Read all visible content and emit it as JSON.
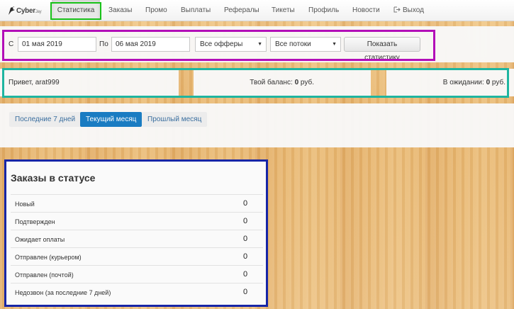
{
  "navbar": {
    "logo_text": "Cyber",
    "logo_small": "Jay",
    "items": [
      {
        "label": "Статистика"
      },
      {
        "label": "Заказы"
      },
      {
        "label": "Промо"
      },
      {
        "label": "Выплаты"
      },
      {
        "label": "Рефералы"
      },
      {
        "label": "Тикеты"
      },
      {
        "label": "Профиль"
      },
      {
        "label": "Новости"
      },
      {
        "label": "Выход"
      }
    ],
    "active_index": 0
  },
  "filters": {
    "from_label": "С",
    "from_value": "01 мая 2019",
    "to_label": "По",
    "to_value": "06 мая 2019",
    "offers_select": "Все офферы",
    "streams_select": "Все потоки",
    "submit_label": "Показать статистику"
  },
  "balance": {
    "greeting": "Привет, arat999",
    "balance_label": "Твой баланс:",
    "balance_value": "0",
    "balance_unit": "руб.",
    "pending_label": "В ожидании:",
    "pending_value": "0",
    "pending_unit": "руб."
  },
  "period_tabs": [
    {
      "label": "Последние 7 дней"
    },
    {
      "label": "Текущий месяц"
    },
    {
      "label": "Прошлый месяц"
    }
  ],
  "period_active_index": 1,
  "orders": {
    "title": "Заказы в статусе",
    "rows": [
      {
        "status": "Новый",
        "count": "0"
      },
      {
        "status": "Подтвержден",
        "count": "0"
      },
      {
        "status": "Ожидает оплаты",
        "count": "0"
      },
      {
        "status": "Отправлен (курьером)",
        "count": "0"
      },
      {
        "status": "Отправлен (почтой)",
        "count": "0"
      },
      {
        "status": "Недозвон (за последние 7 дней)",
        "count": "0"
      }
    ]
  },
  "colors": {
    "active_tab": "#1a7cc2",
    "highlight_nav": "#19c219",
    "highlight_filters": "#b30fb8",
    "highlight_balance": "#1fb5a0",
    "highlight_orders": "#1725a6"
  }
}
